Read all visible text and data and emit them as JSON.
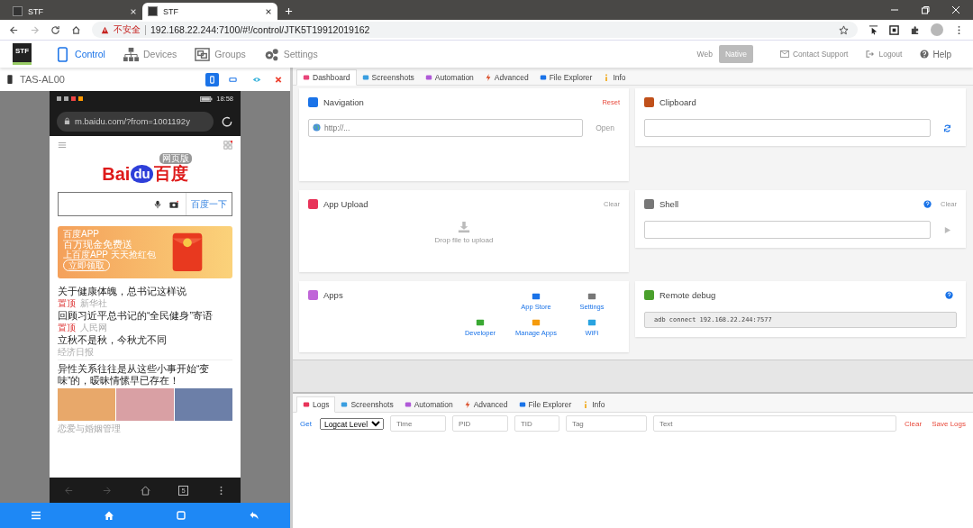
{
  "browser": {
    "tabs": [
      {
        "title": "STF",
        "selected": false
      },
      {
        "title": "STF",
        "selected": true
      }
    ],
    "security_label": "不安全",
    "url": "192.168.22.244:7100/#!/control/JTK5T19912019162"
  },
  "stf_nav": {
    "logo": "STF",
    "items": [
      {
        "label": "Control",
        "selected": true
      },
      {
        "label": "Devices",
        "selected": false
      },
      {
        "label": "Groups",
        "selected": false
      },
      {
        "label": "Settings",
        "selected": false
      }
    ],
    "modes": [
      {
        "label": "Web",
        "selected": false
      },
      {
        "label": "Native",
        "selected": true
      }
    ],
    "links": [
      "Contact Support",
      "Logout",
      "Help"
    ]
  },
  "device": {
    "name": "TAS-AL00",
    "view_buttons": [
      {
        "selected": true
      },
      {
        "selected": false
      }
    ]
  },
  "phone": {
    "status_time": "18:58",
    "browser_url": "m.baidu.com/?from=1001192y",
    "logo": {
      "bai": "Bai",
      "du": "du",
      "chinese": "百度",
      "badge": "网页版"
    },
    "search_button": "百度一下",
    "banner": {
      "app": "百度APP",
      "title": "百万现金免费送",
      "subtitle": "上百度APP 天天抢红包",
      "button": "立即领取"
    },
    "news": [
      {
        "title": "关于健康体魄，总书记这样说",
        "tag": "置顶",
        "source": "新华社"
      },
      {
        "title": "回顾习近平总书记的“全民健身”寄语",
        "tag": "置顶",
        "source": "人民网"
      },
      {
        "title": "立秋不是秋，今秋尤不同",
        "source": "经济日报"
      }
    ],
    "feature": {
      "title": "异性关系往往是从这些小事开始“变味”的，暧昧情愫早已存在！",
      "source": "恋爱与婚姻管理"
    },
    "tab_count": "5"
  },
  "control_tabs": [
    {
      "label": "Dashboard",
      "selected": true
    },
    {
      "label": "Screenshots",
      "selected": false
    },
    {
      "label": "Automation",
      "selected": false
    },
    {
      "label": "Advanced",
      "selected": false
    },
    {
      "label": "File Explorer",
      "selected": false
    },
    {
      "label": "Info",
      "selected": false
    }
  ],
  "dashboard": {
    "navigation": {
      "title": "Navigation",
      "action": "Reset",
      "placeholder": "http://...",
      "button": "Open"
    },
    "clipboard": {
      "title": "Clipboard"
    },
    "app_upload": {
      "title": "App Upload",
      "action": "Clear",
      "drop_hint": "Drop file to upload"
    },
    "shell": {
      "title": "Shell",
      "action": "Clear"
    },
    "apps": {
      "title": "Apps",
      "items": [
        "App Store",
        "Settings",
        "Developer",
        "Manage Apps",
        "WiFi"
      ]
    },
    "remote_debug": {
      "title": "Remote debug",
      "command": "adb connect 192.168.22.244:7577"
    }
  },
  "log_tabs": [
    {
      "label": "Logs",
      "selected": true
    },
    {
      "label": "Screenshots",
      "selected": false
    },
    {
      "label": "Automation",
      "selected": false
    },
    {
      "label": "Advanced",
      "selected": false
    },
    {
      "label": "File Explorer",
      "selected": false
    },
    {
      "label": "Info",
      "selected": false
    }
  ],
  "logs": {
    "get": "Get",
    "level_select": "Logcat Level",
    "filters": [
      {
        "placeholder": "Time"
      },
      {
        "placeholder": "PID"
      },
      {
        "placeholder": "TID"
      },
      {
        "placeholder": "Tag"
      },
      {
        "placeholder": "Text"
      }
    ],
    "clear": "Clear",
    "save": "Save Logs"
  }
}
